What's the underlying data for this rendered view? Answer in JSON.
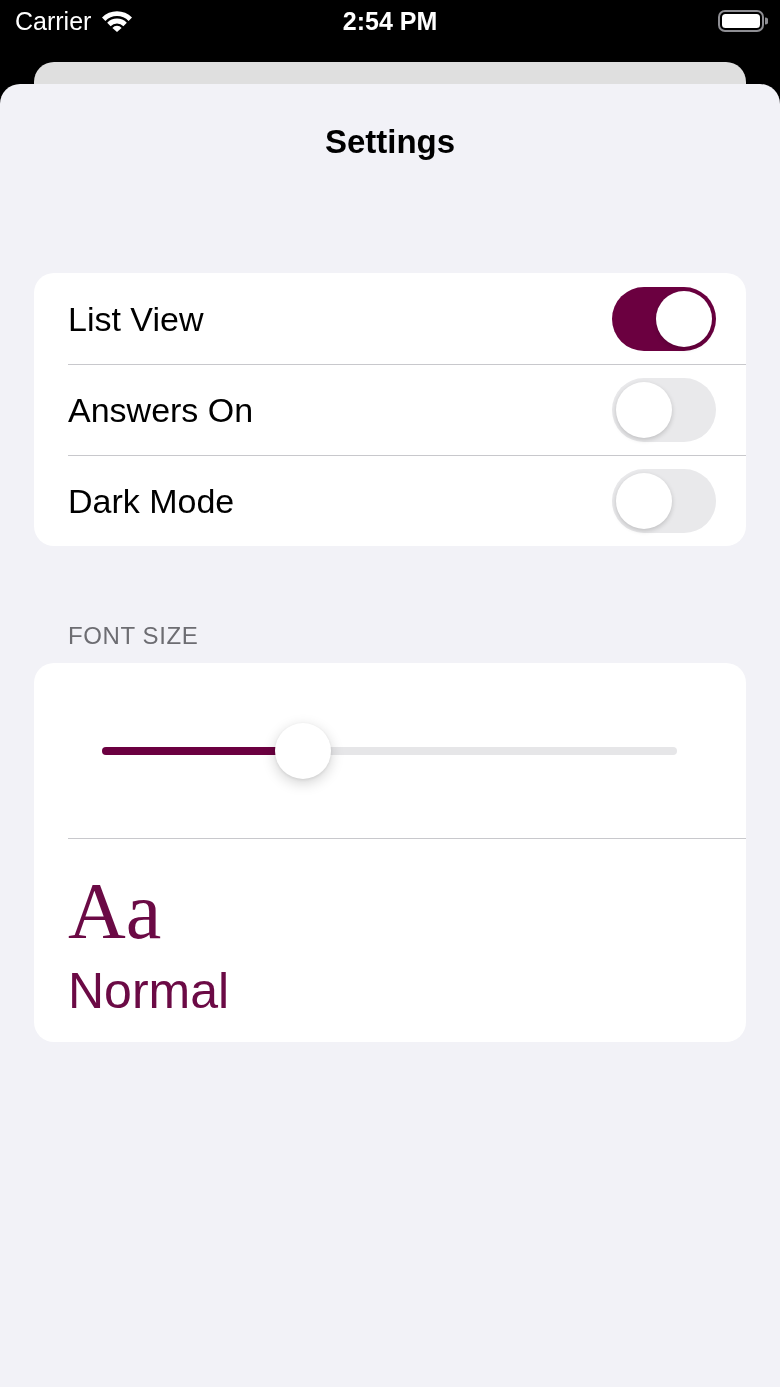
{
  "status_bar": {
    "carrier": "Carrier",
    "time": "2:54 PM"
  },
  "sheet": {
    "title": "Settings"
  },
  "toggles": [
    {
      "label": "List View",
      "on": true
    },
    {
      "label": "Answers On",
      "on": false
    },
    {
      "label": "Dark Mode",
      "on": false
    }
  ],
  "font_size": {
    "header": "FONT SIZE",
    "level": 0.35,
    "sample": "Aa",
    "size_name": "Normal"
  }
}
